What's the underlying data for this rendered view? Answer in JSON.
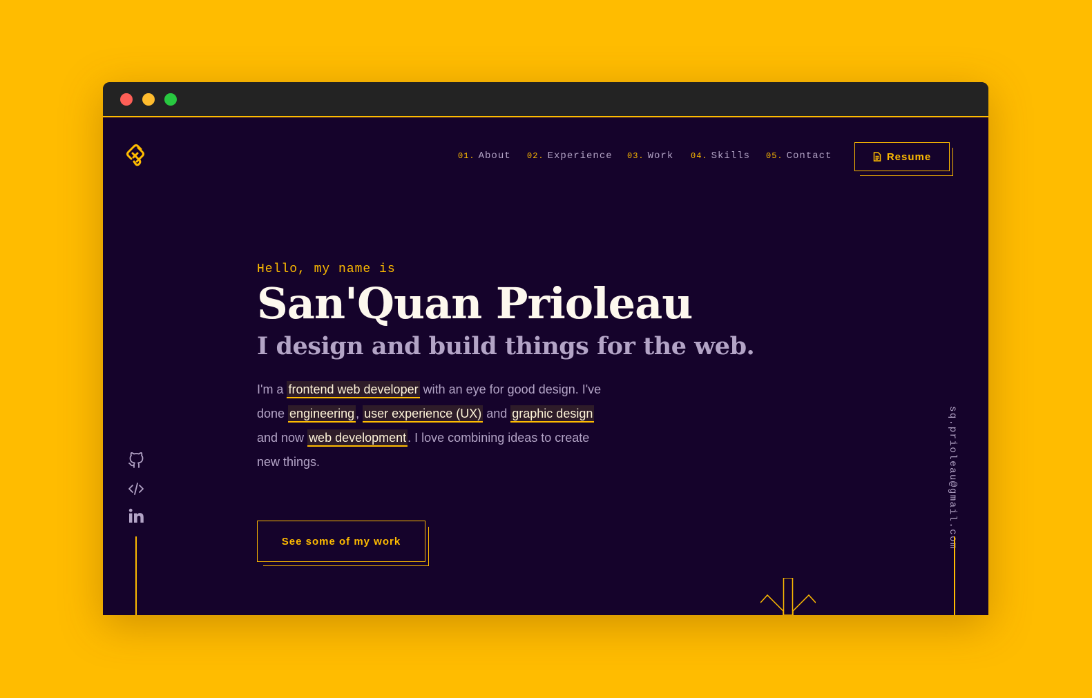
{
  "window": {
    "controls": [
      "close",
      "minimize",
      "zoom"
    ]
  },
  "header": {
    "logo_icon": "sq-monogram-logo-icon",
    "nav": [
      {
        "num": "01.",
        "label": "About"
      },
      {
        "num": "02.",
        "label": "Experience"
      },
      {
        "num": "03.",
        "label": "Work"
      },
      {
        "num": "04.",
        "label": "Skills"
      },
      {
        "num": "05.",
        "label": "Contact"
      }
    ],
    "resume_label": "Resume",
    "resume_icon": "document-icon"
  },
  "hero": {
    "greeting": "Hello, my name is",
    "name": "San'Quan Prioleau",
    "tagline": "I design and build things for the web.",
    "bio": {
      "p1": "I'm a ",
      "h1": "frontend web developer",
      "p2": " with an eye for good design. I've done ",
      "h2": "engineering",
      "p3": ", ",
      "h3": "user experience (UX)",
      "p4": " and ",
      "h4": "graphic design",
      "p5": " and now ",
      "h5": "web development",
      "p6": ". I love combining ideas to create new things."
    },
    "cta_label": "See some of my work"
  },
  "social": [
    {
      "icon": "github-icon"
    },
    {
      "icon": "code-icon"
    },
    {
      "icon": "linkedin-icon"
    }
  ],
  "email": "sq.prioleau@gmail.com",
  "colors": {
    "accent": "#ffbc00",
    "background": "#15032b",
    "text_primary": "#fdf8ee",
    "text_muted": "#b3a4c6",
    "outer_background": "#ffbc00"
  }
}
